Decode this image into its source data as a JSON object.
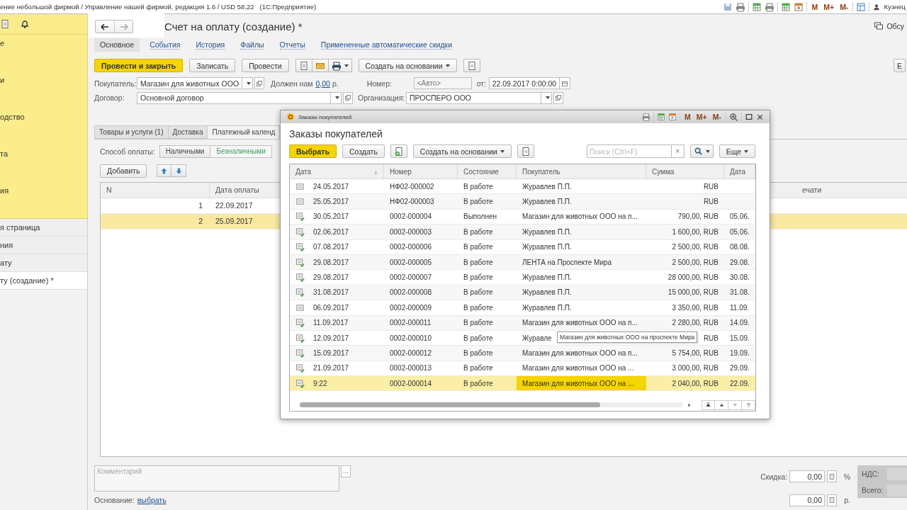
{
  "app_title": "ение небольшой фирмой / Управление нашей фирмой, редакция 1.6 / USD 58,22   (1С:Предприятие)",
  "top_marks": [
    "M",
    "M+",
    "M-"
  ],
  "user": "Кузнец",
  "sidebar": {
    "sections": [
      "е",
      "и",
      "одство",
      "та",
      "ия"
    ],
    "open_windows": [
      {
        "label": "я страница",
        "selected": false
      },
      {
        "label": "ния",
        "selected": false
      },
      {
        "label": "ату",
        "selected": false
      },
      {
        "label": "ту (создание) *",
        "selected": true
      }
    ]
  },
  "form": {
    "title": "Счет на оплату (создание) *",
    "discuss": "Обсу",
    "tabs": [
      {
        "label": "Основное",
        "selected": true
      },
      {
        "label": "События",
        "selected": false
      },
      {
        "label": "История",
        "selected": false
      },
      {
        "label": "Файлы",
        "selected": false
      },
      {
        "label": "Отчеты",
        "selected": false
      },
      {
        "label": "Примененные автоматические скидки",
        "selected": false
      }
    ],
    "buttons": {
      "post_close": "Провести и закрыть",
      "save": "Записать",
      "post": "Провести",
      "create_based": "Создать на основании",
      "more": "Е"
    },
    "customer": {
      "label": "Покупатель:",
      "value": "Магазин для животных ООО"
    },
    "owes": {
      "label": "Должен нам",
      "amount": "0,00",
      "unit": "р."
    },
    "number": {
      "label": "Номер:",
      "placeholder": "<Авто>"
    },
    "date": {
      "label": "от:",
      "value": "22.09.2017  0:00:00"
    },
    "contract": {
      "label": "Договор:",
      "value": "Основной договор"
    },
    "organization": {
      "label": "Организация:",
      "value": "ПРОСПЕРО ООО"
    },
    "inner_tabs": [
      {
        "label": "Товары и услуги (1)",
        "selected": false
      },
      {
        "label": "Доставка",
        "selected": false
      },
      {
        "label": "Платежный календ",
        "selected": true
      }
    ],
    "payment": {
      "label": "Способ оплаты:",
      "methods": [
        {
          "label": "Наличными",
          "selected": false
        },
        {
          "label": "Безналичными",
          "selected": true
        }
      ]
    },
    "add_button": "Добавить",
    "table": {
      "columns": [
        "N",
        "Дата оплаты",
        "ечати"
      ],
      "rows": [
        {
          "n": "1",
          "date": "22.09.2017",
          "selected": false
        },
        {
          "n": "2",
          "date": "25.09.2017",
          "selected": true
        }
      ]
    },
    "comment": {
      "placeholder": "Комментарий",
      "button": "..."
    },
    "basis": {
      "label": "Основание:",
      "link": "выбрать"
    },
    "discount": {
      "label": "Скидка:",
      "percent": "0,00",
      "percent_unit": "%",
      "amount": "0,00",
      "amount_unit": "р."
    },
    "vat": {
      "label": "НДС:"
    },
    "total": {
      "label": "Всего:"
    }
  },
  "dialog": {
    "window_title": "Заказы покупателей",
    "heading": "Заказы покупателей",
    "marks": [
      "M",
      "M+",
      "M-"
    ],
    "buttons": {
      "choose": "Выбрать",
      "create": "Создать",
      "create_based": "Создать на основании",
      "more": "Еще"
    },
    "search": {
      "placeholder": "Поиск (Ctrl+F)",
      "clear": "×"
    },
    "table": {
      "columns": [
        {
          "label": "Дата",
          "sort": "↓"
        },
        {
          "label": "Номер"
        },
        {
          "label": "Состояние"
        },
        {
          "label": "Покупатель"
        },
        {
          "label": "Сумма"
        },
        {
          "label": "Дата"
        }
      ],
      "rows": [
        {
          "kind": "plain",
          "date": "24.05.2017",
          "number": "НФ02-000002",
          "status": "В работе",
          "customer": "Журавлев П.П.",
          "sum": "RUB",
          "date2": "",
          "selected": false
        },
        {
          "kind": "plain",
          "date": "25.05.2017",
          "number": "НФ02-000003",
          "status": "В работе",
          "customer": "Журавлев П.П.",
          "sum": "RUB",
          "date2": "",
          "selected": false
        },
        {
          "kind": "posted",
          "date": "30.05.2017",
          "number": "0002-000004",
          "status": "Выполнен",
          "customer": "Магазин для животных ООО на п...",
          "sum": "790,00, RUB",
          "date2": "05.06.",
          "selected": false
        },
        {
          "kind": "posted",
          "date": "02.06.2017",
          "number": "0002-000003",
          "status": "В работе",
          "customer": "Журавлев П.П.",
          "sum": "1 600,00, RUB",
          "date2": "05.06.",
          "selected": false
        },
        {
          "kind": "posted",
          "date": "07.08.2017",
          "number": "0002-000006",
          "status": "В работе",
          "customer": "Журавлев П.П.",
          "sum": "2 500,00, RUB",
          "date2": "08.08.",
          "selected": false
        },
        {
          "kind": "posted",
          "date": "29.08.2017",
          "number": "0002-000005",
          "status": "В работе",
          "customer": "ЛЕНТА на Проспекте Мира",
          "sum": "2 500,00, RUB",
          "date2": "29.08.",
          "selected": false
        },
        {
          "kind": "posted",
          "date": "29.08.2017",
          "number": "0002-000007",
          "status": "В работе",
          "customer": "Журавлев П.П.",
          "sum": "28 000,00, RUB",
          "date2": "30.08.",
          "selected": false
        },
        {
          "kind": "posted",
          "date": "31.08.2017",
          "number": "0002-000008",
          "status": "В работе",
          "customer": "Журавлев П.П.",
          "sum": "15 000,00, RUB",
          "date2": "31.08.",
          "selected": false
        },
        {
          "kind": "plain",
          "date": "06.09.2017",
          "number": "0002-000009",
          "status": "В работе",
          "customer": "Журавлев П.П.",
          "sum": "3 350,00, RUB",
          "date2": "11.09.",
          "selected": false
        },
        {
          "kind": "posted",
          "date": "11.09.2017",
          "number": "0002-000011",
          "status": "В работе",
          "customer": "Магазин для животных ООО на п...",
          "sum": "2 280,00, RUB",
          "date2": "14.09.",
          "selected": false
        },
        {
          "kind": "posted",
          "date": "12.09.2017",
          "number": "0002-000010",
          "status": "В работе",
          "customer": "Журавле",
          "sum": "RUB",
          "date2": "15.09.",
          "selected": false
        },
        {
          "kind": "posted",
          "date": "15.09.2017",
          "number": "0002-000012",
          "status": "В работе",
          "customer": "Магазин для животных ООО на п...",
          "sum": "5 754,00, RUB",
          "date2": "19.09.",
          "selected": false
        },
        {
          "kind": "posted",
          "date": "21.09.2017",
          "number": "0002-000013",
          "status": "В работе",
          "customer": "Магазин для животных ООО на ...",
          "sum": "3 000,00, RUB",
          "date2": "29.09.",
          "selected": false
        },
        {
          "kind": "posted",
          "date": "9:22",
          "number": "0002-000014",
          "status": "В работе",
          "customer": "Магазин для животных ООО на ...",
          "sum": "2 040,00, RUB",
          "date2": "22.09.",
          "selected": true
        }
      ]
    },
    "tooltip": "Магазин для животных ООО на проспекте Мира"
  }
}
